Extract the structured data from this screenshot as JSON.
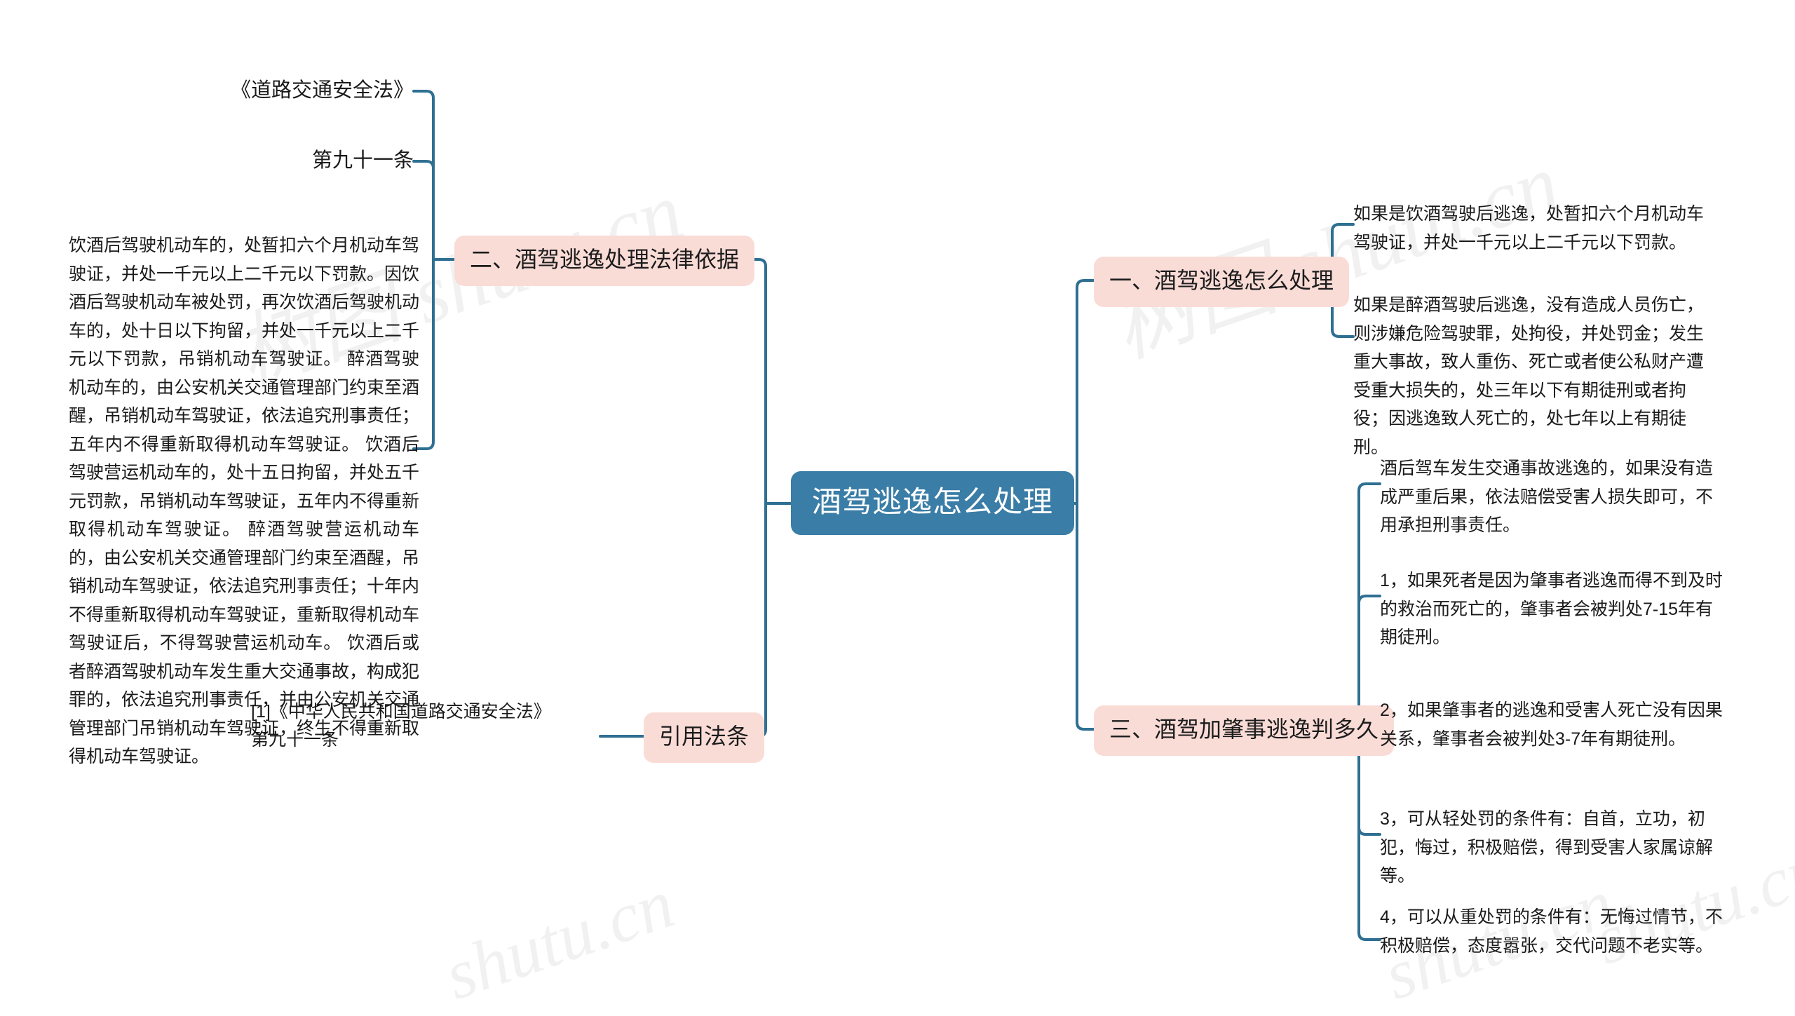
{
  "theme": {
    "root_fill": "#3a7da6",
    "root_text": "#ffffff",
    "branch_fill": "#fadcd7",
    "branch_text": "#1c1c1c",
    "link_color": "#2f6f92",
    "body_text": "#1a1a1a",
    "background": "#ffffff"
  },
  "root": {
    "label": "酒驾逃逸怎么处理"
  },
  "branches": {
    "right_1": {
      "label": "一、酒驾逃逸怎么处理",
      "leaves": [
        "如果是饮酒驾驶后逃逸，处暂扣六个月机动车驾驶证，并处一千元以上二千元以下罚款。",
        "如果是醉酒驾驶后逃逸，没有造成人员伤亡，则涉嫌危险驾驶罪，处拘役，并处罚金；发生重大事故，致人重伤、死亡或者使公私财产遭受重大损失的，处三年以下有期徒刑或者拘役；因逃逸致人死亡的，处七年以上有期徒刑。"
      ]
    },
    "right_3": {
      "label": "三、酒驾加肇事逃逸判多久",
      "leaves": [
        "酒后驾车发生交通事故逃逸的，如果没有造成严重后果，依法赔偿受害人损失即可，不用承担刑事责任。",
        "1，如果死者是因为肇事者逃逸而得不到及时的救治而死亡的，肇事者会被判处7-15年有期徒刑。",
        "2，如果肇事者的逃逸和受害人死亡没有因果关系，肇事者会被判处3-7年有期徒刑。",
        "3，可从轻处罚的条件有：自首，立功，初犯，悔过，积极赔偿，得到受害人家属谅解等。",
        "4，可以从重处罚的条件有：无悔过情节，不积极赔偿，态度嚣张，交代问题不老实等。"
      ]
    },
    "left_2": {
      "label": "二、酒驾逃逸处理法律依据",
      "sub_nodes": [
        "《道路交通安全法》",
        "第九十一条"
      ],
      "body": "饮酒后驾驶机动车的，处暂扣六个月机动车驾驶证，并处一千元以上二千元以下罚款。因饮酒后驾驶机动车被处罚，再次饮酒后驾驶机动车的，处十日以下拘留，并处一千元以上二千元以下罚款，吊销机动车驾驶证。 醉酒驾驶机动车的，由公安机关交通管理部门约束至酒醒，吊销机动车驾驶证，依法追究刑事责任；五年内不得重新取得机动车驾驶证。 饮酒后驾驶营运机动车的，处十五日拘留，并处五千元罚款，吊销机动车驾驶证，五年内不得重新取得机动车驾驶证。 醉酒驾驶营运机动车的，由公安机关交通管理部门约束至酒醒，吊销机动车驾驶证，依法追究刑事责任；十年内不得重新取得机动车驾驶证，重新取得机动车驾驶证后，不得驾驶营运机动车。 饮酒后或者醉酒驾驶机动车发生重大交通事故，构成犯罪的，依法追究刑事责任，并由公安机关交通管理部门吊销机动车驾驶证，终生不得重新取得机动车驾驶证。"
    },
    "left_cite": {
      "label": "引用法条",
      "body": "[1]《中华人民共和国道路交通安全法》 第九十一条"
    }
  },
  "watermarks": [
    "树图 shutu.cn",
    "树图 shutu.cn",
    "shutu.cn",
    "shutu.cn",
    "shutu.cn"
  ]
}
